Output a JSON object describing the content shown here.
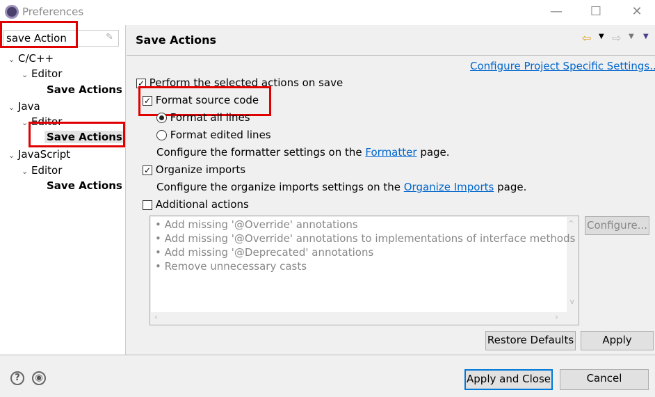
{
  "window": {
    "title": "Preferences",
    "minimize": "—",
    "maximize": "☐",
    "close": "✕"
  },
  "sidebar": {
    "filter_value": "save Action",
    "tree": [
      {
        "label": "C/C++",
        "children": [
          {
            "label": "Editor",
            "children": [
              {
                "label": "Save Actions"
              }
            ]
          }
        ]
      },
      {
        "label": "Java",
        "children": [
          {
            "label": "Editor",
            "children": [
              {
                "label": "Save Actions",
                "selected": true
              }
            ]
          }
        ]
      },
      {
        "label": "JavaScript",
        "children": [
          {
            "label": "Editor",
            "children": [
              {
                "label": "Save Actions"
              }
            ]
          }
        ]
      }
    ]
  },
  "main": {
    "title": "Save Actions",
    "configure_project_link": "Configure Project Specific Settings...",
    "perform_on_save": {
      "label": "Perform the selected actions on save",
      "checked": true
    },
    "format_source": {
      "label": "Format source code",
      "checked": true
    },
    "format_all": {
      "label": "Format all lines",
      "selected": true
    },
    "format_edited": {
      "label": "Format edited lines",
      "selected": false
    },
    "formatter_text_pre": "Configure the formatter settings on the",
    "formatter_link": "Formatter",
    "formatter_text_post": "page.",
    "organize_imports": {
      "label": "Organize imports",
      "checked": true
    },
    "organize_text_pre": "Configure the organize imports settings on the",
    "organize_link": "Organize Imports",
    "organize_text_post": "page.",
    "additional_actions": {
      "label": "Additional actions",
      "checked": false
    },
    "additional_list": [
      "Add missing '@Override' annotations",
      "Add missing '@Override' annotations to implementations of interface methods",
      "Add missing '@Deprecated' annotations",
      "Remove unnecessary casts"
    ],
    "configure_button": "Configure...",
    "restore_defaults": "Restore Defaults",
    "apply": "Apply"
  },
  "footer": {
    "apply_close": "Apply and Close",
    "cancel": "Cancel"
  },
  "colors": {
    "highlight": "#e00000",
    "link": "#0066cc",
    "focus": "#0078d7"
  }
}
